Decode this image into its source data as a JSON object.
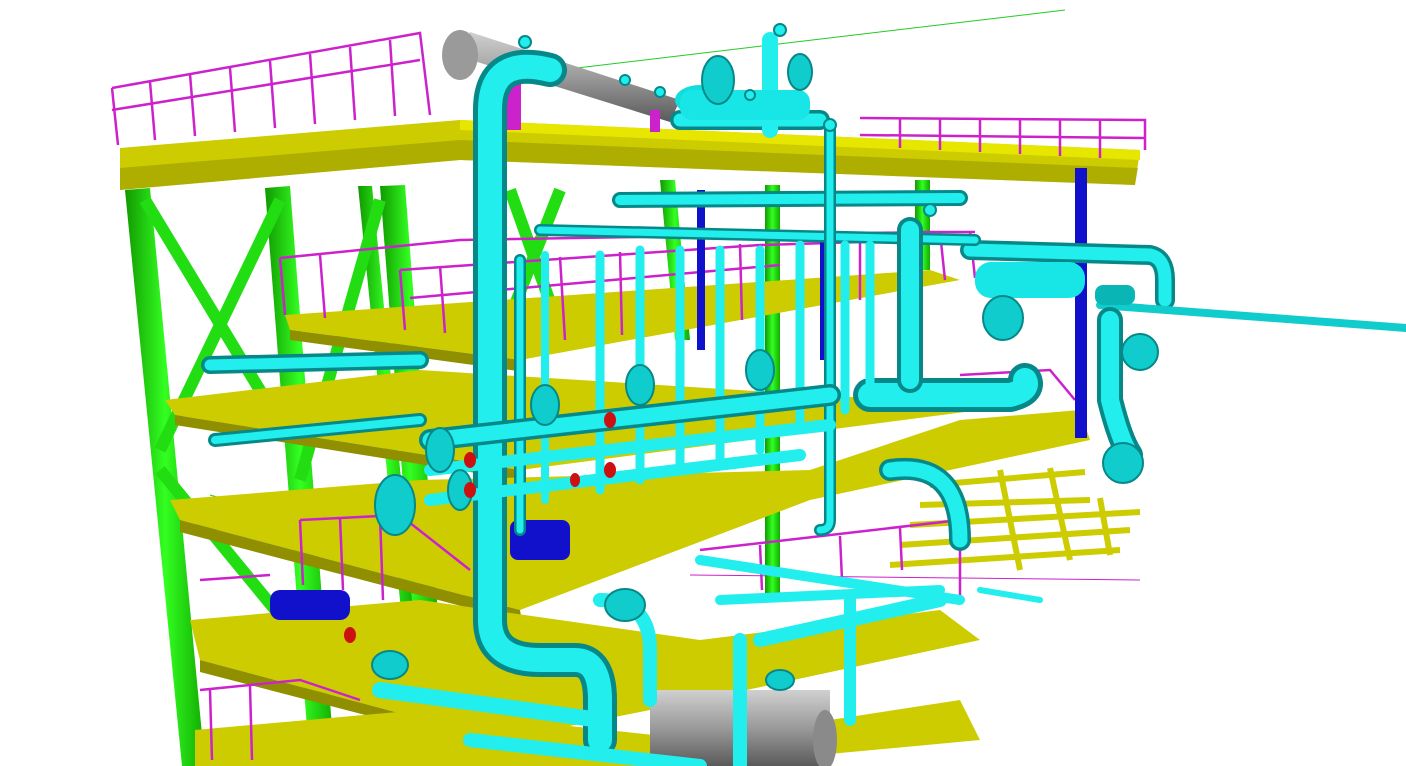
{
  "scene": {
    "description_visible_text": "",
    "colors": {
      "background": "#ffffff",
      "column_steel": "#22dd11",
      "column_steel_dark": "#119900",
      "deck_beam": "#cccc00",
      "deck_beam_dark": "#8f8f00",
      "handrail": "#cc22cc",
      "pipe": "#11dddd",
      "pipe_dark": "#088f8f",
      "vessel_gray": "#a8a8a8",
      "vessel_gray_dark": "#6a6a6a",
      "support_blue": "#1111cc",
      "flange_red": "#cc1111",
      "guide_line_green": "#22cc22"
    }
  }
}
